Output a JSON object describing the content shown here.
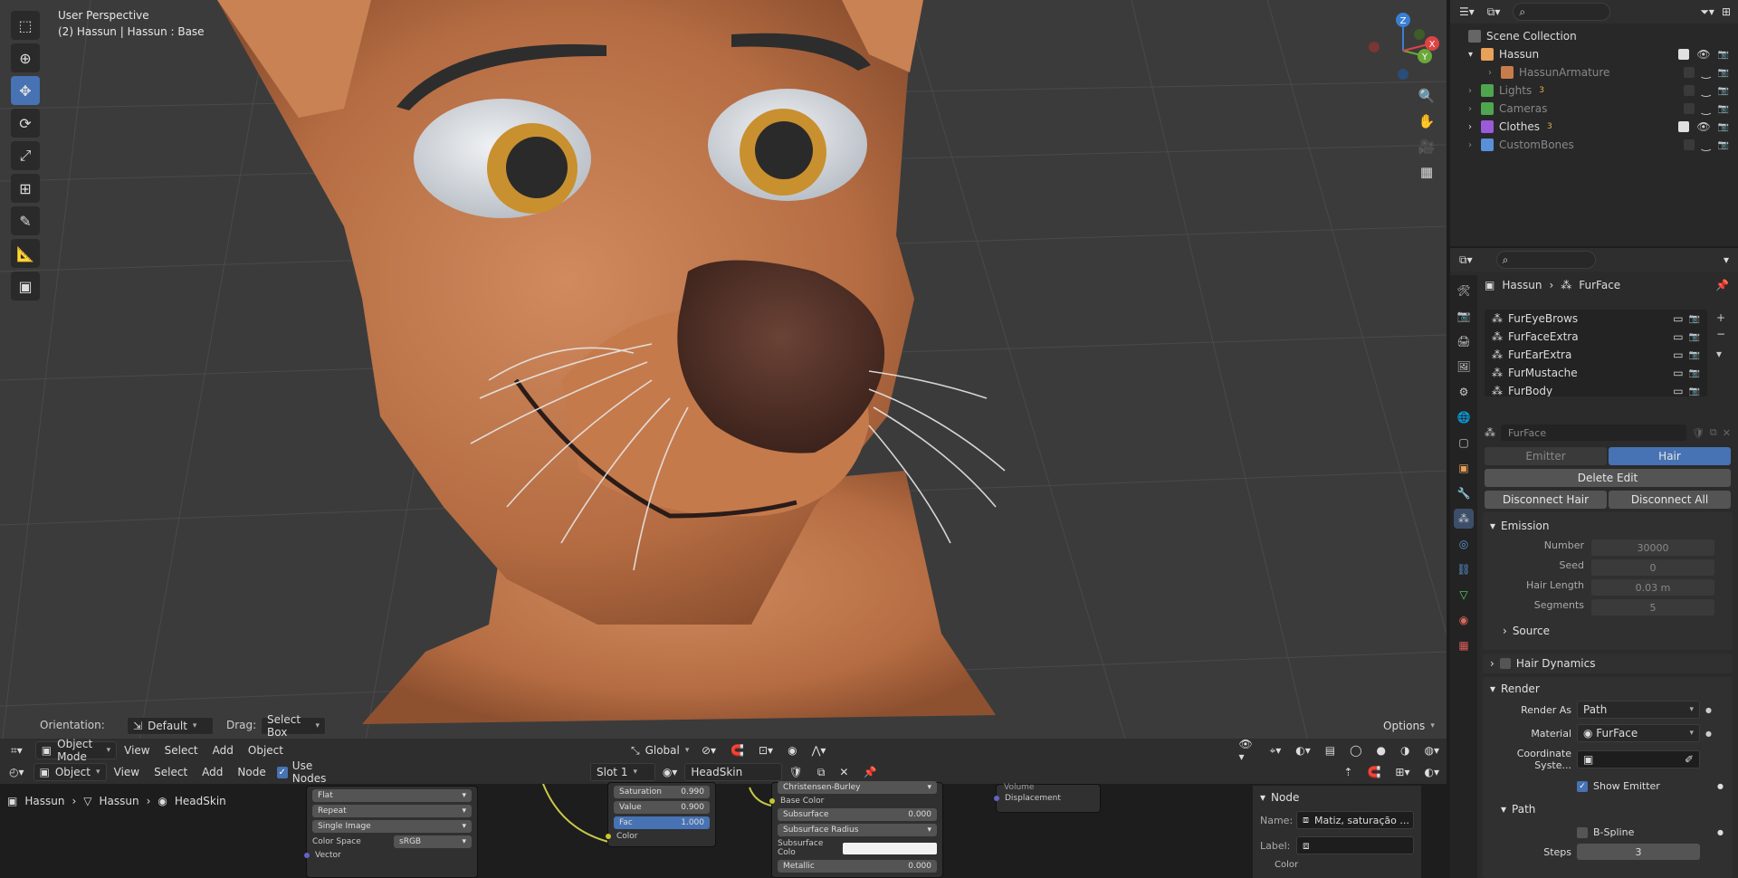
{
  "viewport": {
    "title": "User Perspective",
    "subtitle": "(2) Hassun | Hassun : Base",
    "orientation_label": "Orientation:",
    "orientation_value": "Default",
    "drag_label": "Drag:",
    "drag_value": "Select Box",
    "options_label": "Options",
    "mode": "Object Mode",
    "menus": [
      "View",
      "Select",
      "Add",
      "Object"
    ],
    "transform_space": "Global",
    "gizmo_axes": [
      "Z",
      "Y",
      "X"
    ]
  },
  "node_editor": {
    "type": "Object",
    "menus": [
      "View",
      "Select",
      "Add",
      "Node"
    ],
    "use_nodes_label": "Use Nodes",
    "use_nodes_checked": true,
    "slot": "Slot 1",
    "material": "HeadSkin",
    "breadcrumb": [
      "Hassun",
      "Hassun",
      "HeadSkin"
    ],
    "image_node": {
      "interp": "Flat",
      "extension": "Repeat",
      "source": "Single Image",
      "color_space_label": "Color Space",
      "color_space": "sRGB",
      "vector_label": "Vector"
    },
    "hsv_node": {
      "saturation_label": "Saturation",
      "saturation": "0.990",
      "value_label": "Value",
      "value": "0.900",
      "fac_label": "Fac",
      "fac": "1.000",
      "color_label": "Color"
    },
    "bsdf_node": {
      "header": "Christensen-Burley",
      "base_color": "Base Color",
      "subsurface_label": "Subsurface",
      "subsurface": "0.000",
      "subsurface_radius": "Subsurface Radius",
      "subsurface_color": "Subsurface Colo",
      "metallic_label": "Metallic",
      "metallic": "0.000"
    },
    "output_node": {
      "volume": "Volume",
      "displacement": "Displacement"
    },
    "sidebar": {
      "title": "Node",
      "name_label": "Name:",
      "name_value": "Matiz, saturação ...",
      "label_label": "Label:",
      "color_label": "Color"
    }
  },
  "outliner": {
    "root": "Scene Collection",
    "items": [
      {
        "name": "Hassun",
        "indent": 1,
        "color": "#e8a05a",
        "dim": false,
        "expanded": true
      },
      {
        "name": "HassunArmature",
        "indent": 2,
        "color": "#c77c4c",
        "dim": true,
        "expanded": false
      },
      {
        "name": "Lights",
        "indent": 1,
        "color": "#4fa64f",
        "dim": true,
        "badge": "3"
      },
      {
        "name": "Cameras",
        "indent": 1,
        "color": "#4fa64f",
        "dim": true,
        "badge": ""
      },
      {
        "name": "Clothes",
        "indent": 1,
        "color": "#9a5ad9",
        "dim": false,
        "badge": "3"
      },
      {
        "name": "CustomBones",
        "indent": 1,
        "color": "#5a8fd9",
        "dim": true,
        "badge": ""
      }
    ]
  },
  "properties": {
    "breadcrumb_object": "Hassun",
    "breadcrumb_system": "FurFace",
    "particle_systems": [
      "FurEyeBrows",
      "FurFaceExtra",
      "FurEarExtra",
      "FurMustache",
      "FurBody"
    ],
    "settings_name": "FurFace",
    "type_tabs": [
      "Emitter",
      "Hair"
    ],
    "active_type": "Hair",
    "delete_edit": "Delete Edit",
    "disconnect_hair": "Disconnect Hair",
    "disconnect_all": "Disconnect All",
    "emission": {
      "title": "Emission",
      "number_label": "Number",
      "number": "30000",
      "seed_label": "Seed",
      "seed": "0",
      "hair_length_label": "Hair Length",
      "hair_length": "0.03 m",
      "segments_label": "Segments",
      "segments": "5",
      "source": "Source"
    },
    "hair_dynamics": "Hair Dynamics",
    "render": {
      "title": "Render",
      "render_as_label": "Render As",
      "render_as": "Path",
      "material_label": "Material",
      "material": "FurFace",
      "coord_label": "Coordinate Syste...",
      "show_emitter": "Show Emitter",
      "path_title": "Path",
      "bspline": "B-Spline",
      "steps_label": "Steps",
      "steps": "3"
    }
  },
  "colors": {
    "accent": "#4772b3",
    "skin": "#c67c4f",
    "nose": "#4e2f26"
  }
}
